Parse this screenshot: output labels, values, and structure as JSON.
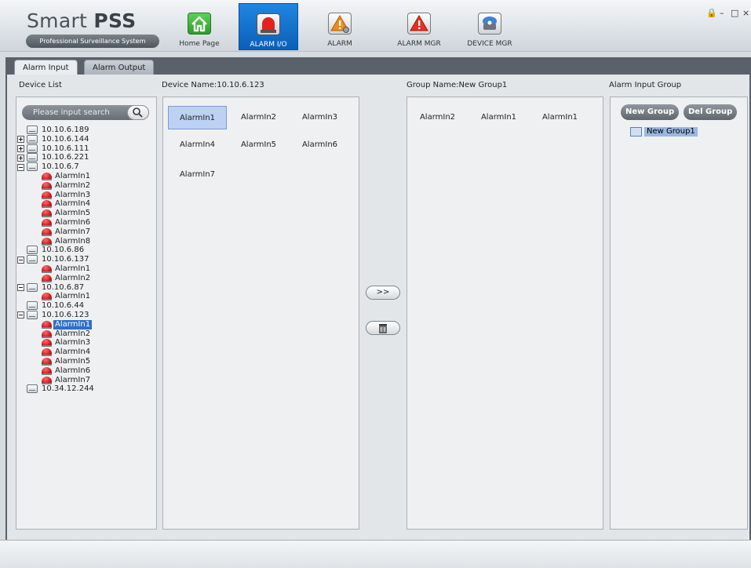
{
  "app": {
    "title_light": "Smart ",
    "title_bold": "PSS",
    "subtitle": "Professional Surveillance System"
  },
  "nav": [
    {
      "label": "Home Page",
      "icon": "home-icon"
    },
    {
      "label": "ALARM I/O",
      "icon": "alarm-light-icon"
    },
    {
      "label": "ALARM",
      "icon": "alarm-settings-icon"
    },
    {
      "label": "ALARM MGR",
      "icon": "warning-icon"
    },
    {
      "label": "DEVICE MGR",
      "icon": "device-icon"
    }
  ],
  "window_controls": {
    "lock": "🔒",
    "minimize": "–",
    "maximize": "□",
    "close": "×"
  },
  "tabs": {
    "alarm_input": "Alarm Input",
    "alarm_output": "Alarm Output"
  },
  "headers": {
    "device_list": "Device List",
    "device_name": "Device Name:10.10.6.123",
    "group_name": "Group Name:New Group1",
    "alarm_input_group": "Alarm Input Group"
  },
  "search": {
    "placeholder": "Please input search"
  },
  "tree": [
    {
      "type": "device",
      "label": "10.10.6.189",
      "exp": ""
    },
    {
      "type": "device",
      "label": "10.10.6.144",
      "exp": "+"
    },
    {
      "type": "device",
      "label": "10.10.6.111",
      "exp": "+"
    },
    {
      "type": "device",
      "label": "10.10.6.221",
      "exp": "+"
    },
    {
      "type": "device",
      "label": "10.10.6.7",
      "exp": "−"
    },
    {
      "type": "alarm",
      "label": "AlarmIn1"
    },
    {
      "type": "alarm",
      "label": "AlarmIn2"
    },
    {
      "type": "alarm",
      "label": "AlarmIn3"
    },
    {
      "type": "alarm",
      "label": "AlarmIn4"
    },
    {
      "type": "alarm",
      "label": "AlarmIn5"
    },
    {
      "type": "alarm",
      "label": "AlarmIn6"
    },
    {
      "type": "alarm",
      "label": "AlarmIn7"
    },
    {
      "type": "alarm",
      "label": "AlarmIn8"
    },
    {
      "type": "device",
      "label": "10.10.6.86",
      "exp": ""
    },
    {
      "type": "device",
      "label": "10.10.6.137",
      "exp": "−"
    },
    {
      "type": "alarm",
      "label": "AlarmIn1"
    },
    {
      "type": "alarm",
      "label": "AlarmIn2"
    },
    {
      "type": "device",
      "label": "10.10.6.87",
      "exp": "−"
    },
    {
      "type": "alarm",
      "label": "AlarmIn1"
    },
    {
      "type": "device",
      "label": "10.10.6.44",
      "exp": ""
    },
    {
      "type": "device",
      "label": "10.10.6.123",
      "exp": "−"
    },
    {
      "type": "alarm",
      "label": "AlarmIn1",
      "selected": true
    },
    {
      "type": "alarm",
      "label": "AlarmIn2"
    },
    {
      "type": "alarm",
      "label": "AlarmIn3"
    },
    {
      "type": "alarm",
      "label": "AlarmIn4"
    },
    {
      "type": "alarm",
      "label": "AlarmIn5"
    },
    {
      "type": "alarm",
      "label": "AlarmIn6"
    },
    {
      "type": "alarm",
      "label": "AlarmIn7"
    },
    {
      "type": "device",
      "label": "10.34.12.244",
      "exp": ""
    }
  ],
  "device_alarms": [
    "AlarmIn1",
    "AlarmIn2",
    "AlarmIn3",
    "AlarmIn4",
    "AlarmIn5",
    "AlarmIn6",
    "AlarmIn7"
  ],
  "group_alarms": [
    "AlarmIn2",
    "AlarmIn1",
    "AlarmIn1"
  ],
  "buttons": {
    "add": ">>",
    "delete_icon": "trash-icon",
    "new_group": "New Group",
    "del_group": "Del Group"
  },
  "groups": [
    "New Group1"
  ],
  "colors": {
    "nav_active": "#1a7ad6",
    "selection": "#2f6fc8",
    "alarm_red": "#d01a1e",
    "home_green": "#3fae3c",
    "warning_orange": "#f08a18"
  }
}
